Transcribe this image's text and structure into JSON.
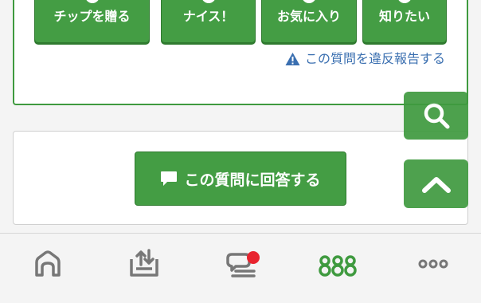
{
  "reactions": [
    {
      "label": "チップを贈る"
    },
    {
      "label": "ナイス！"
    },
    {
      "label": "お気に入り"
    },
    {
      "label": "知りたい"
    }
  ],
  "report_link": {
    "label": "この質問を違反報告する",
    "icon": "warning-icon"
  },
  "answer_button": {
    "label": "この質問に回答する",
    "icon": "comment-icon"
  },
  "floating": {
    "search_icon": "search-icon",
    "top_icon": "chevron-up-icon"
  },
  "bottom_nav": {
    "items": [
      {
        "icon": "home-icon",
        "active": false
      },
      {
        "icon": "upload-tray-icon",
        "active": false
      },
      {
        "icon": "chat-icon",
        "active": false,
        "badge": true
      },
      {
        "icon": "groups-icon",
        "active": true
      },
      {
        "icon": "more-icon",
        "active": false
      }
    ]
  },
  "colors": {
    "green": "#449d44",
    "link_blue": "#3a6fb0",
    "badge_red": "#e8242f",
    "nav_gray": "#777777"
  }
}
